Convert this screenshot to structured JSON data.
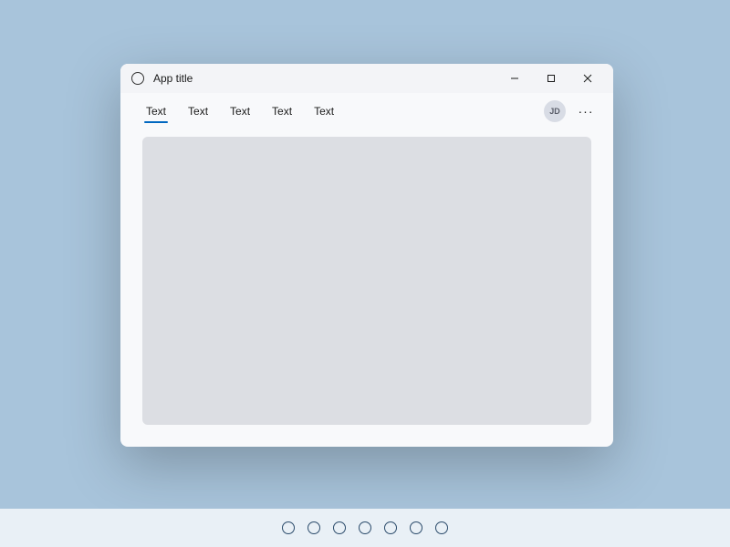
{
  "window": {
    "title": "App title",
    "controls": {
      "minimize": "minimize",
      "maximize": "maximize",
      "close": "close"
    }
  },
  "tabs": [
    {
      "label": "Text",
      "active": true
    },
    {
      "label": "Text",
      "active": false
    },
    {
      "label": "Text",
      "active": false
    },
    {
      "label": "Text",
      "active": false
    },
    {
      "label": "Text",
      "active": false
    }
  ],
  "user": {
    "initials": "JD"
  },
  "more_label": "···",
  "taskbar": {
    "item_count": 7
  }
}
